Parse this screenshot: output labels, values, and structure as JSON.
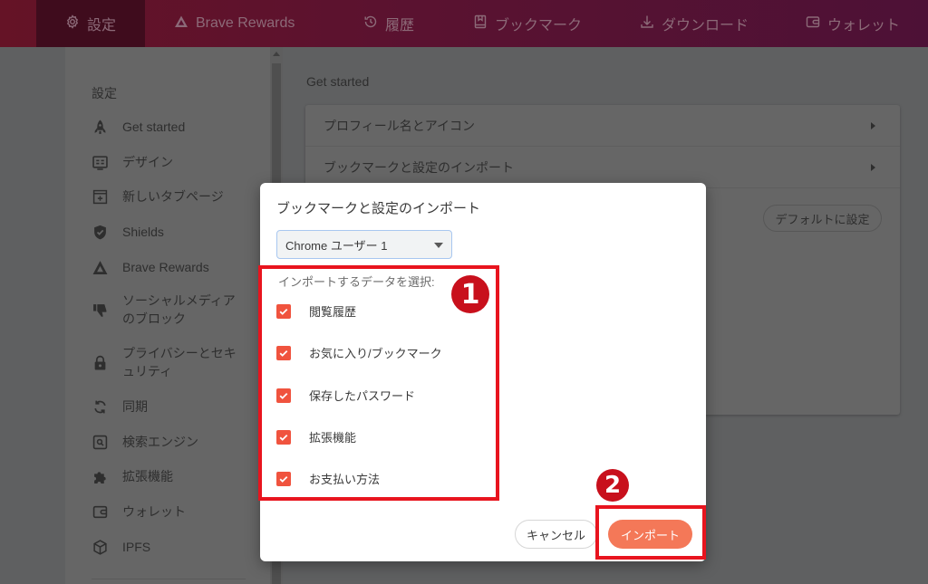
{
  "topnav": {
    "tabs": [
      {
        "label": "設定",
        "icon": "gear-icon",
        "active": true
      },
      {
        "label": "Brave Rewards",
        "icon": "brave-rewards-triangle-icon",
        "active": false
      },
      {
        "label": "履歴",
        "icon": "history-clock-icon",
        "active": false
      },
      {
        "label": "ブックマーク",
        "icon": "bookmark-book-icon",
        "active": false
      },
      {
        "label": "ダウンロード",
        "icon": "download-icon",
        "active": false
      },
      {
        "label": "ウォレット",
        "icon": "wallet-icon",
        "active": false
      }
    ]
  },
  "sidebar": {
    "title": "設定",
    "items": [
      {
        "label": "Get started",
        "icon": "rocket-icon"
      },
      {
        "label": "デザイン",
        "icon": "appearance-icon"
      },
      {
        "label": "新しいタブページ",
        "icon": "new-tab-icon"
      },
      {
        "label": "Shields",
        "icon": "shield-icon"
      },
      {
        "label": "Brave Rewards",
        "icon": "brave-rewards-triangle-icon"
      },
      {
        "label": "ソーシャルメディア\nのブロック",
        "line1": "ソーシャルメディア",
        "line2": "のブロック",
        "icon": "thumbs-down-icon"
      },
      {
        "label": "プライバシーとセキュリティ",
        "line1": "プライバシーとセキ",
        "line2": "ュリティ",
        "icon": "lock-icon"
      },
      {
        "label": "同期",
        "icon": "sync-icon"
      },
      {
        "label": "検索エンジン",
        "icon": "search-engine-icon"
      },
      {
        "label": "拡張機能",
        "icon": "puzzle-icon"
      },
      {
        "label": "ウォレット",
        "icon": "wallet-icon"
      },
      {
        "label": "IPFS",
        "icon": "cube-icon"
      }
    ]
  },
  "main": {
    "section_title": "Get started",
    "rows": [
      {
        "label": "プロフィール名とアイコン"
      },
      {
        "label": "ブックマークと設定のインポート"
      }
    ],
    "default_button": "デフォルトに設定"
  },
  "dialog": {
    "title": "ブックマークと設定のインポート",
    "profile_select": {
      "value": "Chrome ユーザー 1"
    },
    "data_label": "インポートするデータを選択:",
    "options": [
      {
        "label": "閲覧履歴",
        "checked": true
      },
      {
        "label": "お気に入り/ブックマーク",
        "checked": true
      },
      {
        "label": "保存したパスワード",
        "checked": true
      },
      {
        "label": "拡張機能",
        "checked": true
      },
      {
        "label": "お支払い方法",
        "checked": true
      }
    ],
    "cancel_label": "キャンセル",
    "import_label": "インポート",
    "accent_color": "#f47858",
    "checkbox_color": "#f0533e"
  },
  "annotations": {
    "badge_1": "1",
    "badge_2": "2",
    "color": "#e8141e"
  }
}
